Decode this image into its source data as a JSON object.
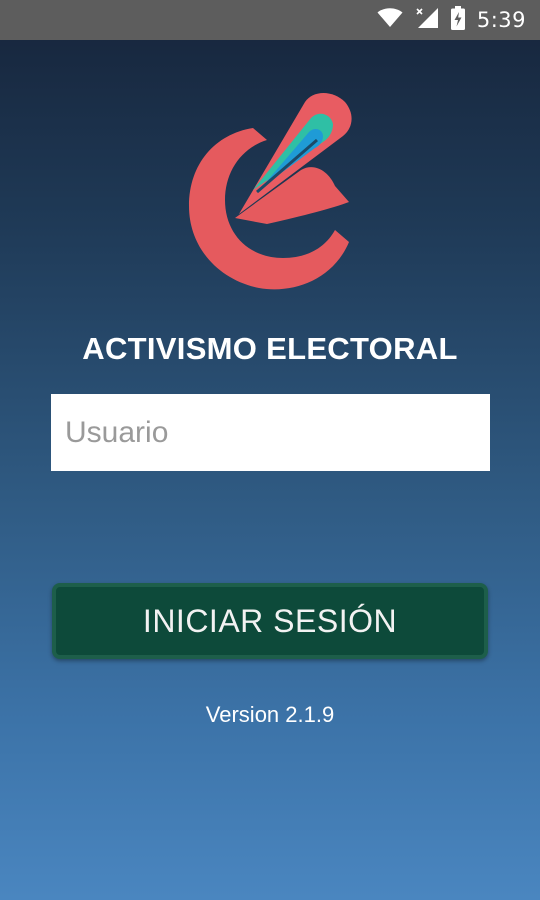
{
  "status_bar": {
    "time": "5:39",
    "icons": [
      "wifi-icon",
      "cell-signal-icon",
      "battery-charging-icon"
    ]
  },
  "app": {
    "title": "ACTIVISMO ELECTORAL",
    "logo": "activismo-electoral-logo"
  },
  "login": {
    "username_placeholder": "Usuario",
    "username_value": "",
    "submit_label": "INICIAR SESIÓN"
  },
  "footer": {
    "version": "Version 2.1.9"
  },
  "colors": {
    "status_bar": "#5d5d5d",
    "background_top": "#16243a",
    "background_bottom": "#4a86c0",
    "logo_red": "#e85a5f",
    "logo_teal": "#2fbfa5",
    "logo_blue": "#1f9bd6",
    "button": "#0d4a3a",
    "text": "#ffffff"
  }
}
